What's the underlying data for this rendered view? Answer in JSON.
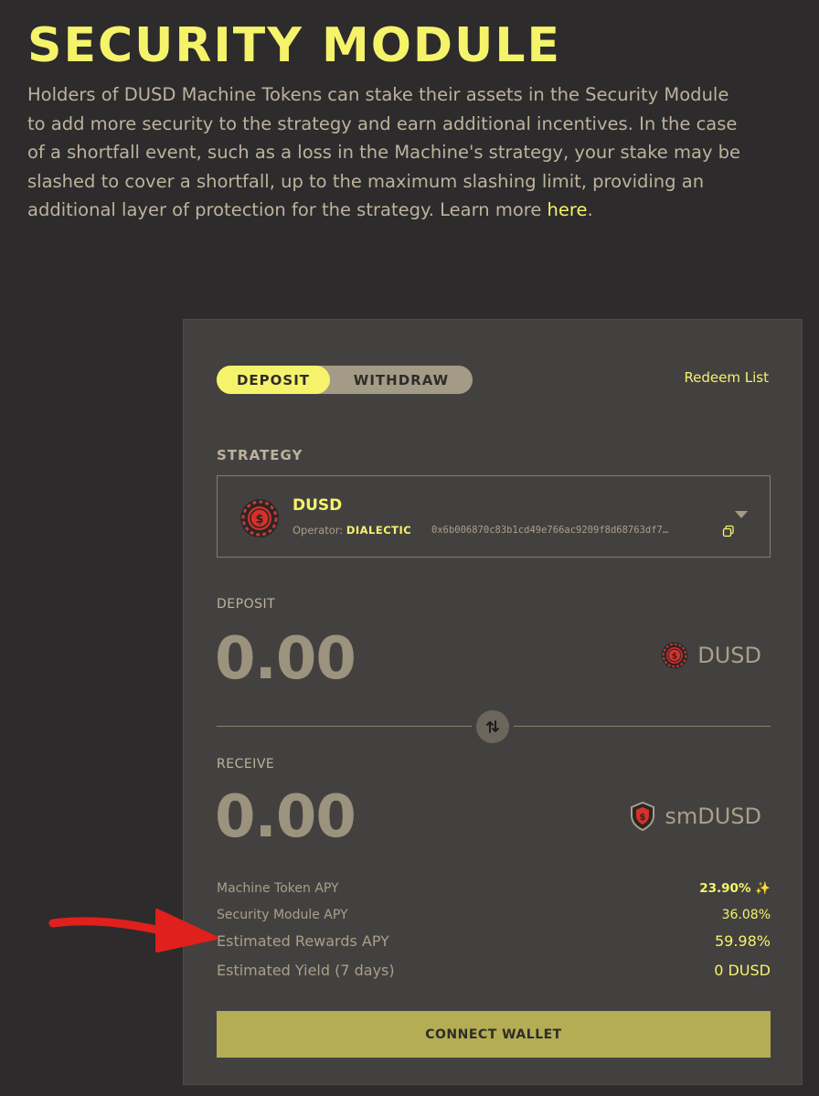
{
  "header": {
    "title": "SECURITY MODULE",
    "description": "Holders of DUSD Machine Tokens can stake their assets in the Security Module to add more security to the strategy and earn additional incentives. In the case of a shortfall event, such as a loss in the Machine's strategy, your stake may be slashed to cover a shortfall, up to the maximum slashing limit, providing an additional layer of protection for the strategy. Learn more ",
    "link_label": "here",
    "link_suffix": "."
  },
  "tabs": {
    "deposit": "DEPOSIT",
    "withdraw": "WITHDRAW",
    "active": "deposit"
  },
  "redeem_label": "Redeem List",
  "strategy": {
    "label": "STRATEGY",
    "name": "DUSD",
    "operator_label": "Operator: ",
    "operator_name": "DIALECTIC",
    "address": "0x6b006870c83b1cd49e766ac9209f8d68763df7…",
    "icon": "dusd-token-icon"
  },
  "deposit": {
    "label": "DEPOSIT",
    "amount": "0.00",
    "unit": "DUSD"
  },
  "receive": {
    "label": "RECEIVE",
    "amount": "0.00",
    "unit": "smDUSD"
  },
  "stats": {
    "machine_apy_label": "Machine Token APY",
    "machine_apy_value": "23.90%",
    "security_apy_label": "Security Module APY",
    "security_apy_value": "36.08%",
    "rewards_apy_label": "Estimated Rewards APY",
    "rewards_apy_value": "59.98%",
    "yield_label": "Estimated Yield (7 days)",
    "yield_value": "0 DUSD"
  },
  "connect_label": "CONNECT WALLET",
  "colors": {
    "accent": "#f5f36a",
    "background": "#2d2b2c",
    "card": "#434140",
    "button": "#b4ad53",
    "annotation_arrow": "#e0201c"
  }
}
